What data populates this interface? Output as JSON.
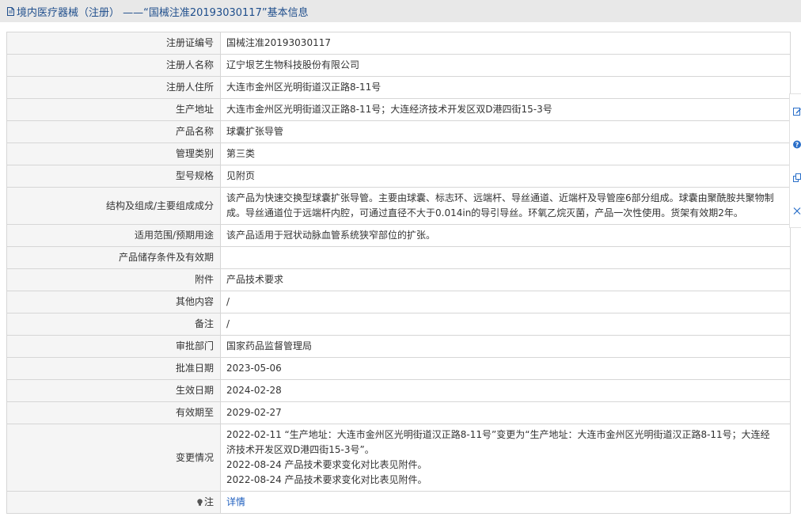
{
  "header": {
    "title": "境内医疗器械（注册） ——“国械注准20193030117”基本信息",
    "icon": "document-icon"
  },
  "rows": [
    {
      "label": "注册证编号",
      "lines": [
        "国械注准20193030117"
      ]
    },
    {
      "label": "注册人名称",
      "lines": [
        "辽宁垠艺生物科技股份有限公司"
      ]
    },
    {
      "label": "注册人住所",
      "lines": [
        "大连市金州区光明街道汉正路8-11号"
      ]
    },
    {
      "label": "生产地址",
      "lines": [
        "大连市金州区光明街道汉正路8-11号；大连经济技术开发区双D港四街15-3号"
      ]
    },
    {
      "label": "产品名称",
      "lines": [
        "球囊扩张导管"
      ]
    },
    {
      "label": "管理类别",
      "lines": [
        "第三类"
      ]
    },
    {
      "label": "型号规格",
      "lines": [
        "见附页"
      ]
    },
    {
      "label": "结构及组成/主要组成成分",
      "lines": [
        "该产品为快速交换型球囊扩张导管。主要由球囊、标志环、远端杆、导丝通道、近端杆及导管座6部分组成。球囊由聚酰胺共聚物制",
        "成。导丝通道位于远端杆内腔，可通过直径不大于0.014in的导引导丝。环氧乙烷灭菌，产品一次性使用。货架有效期2年。"
      ]
    },
    {
      "label": "适用范围/预期用途",
      "lines": [
        "该产品适用于冠状动脉血管系统狭窄部位的扩张。"
      ]
    },
    {
      "label": "产品储存条件及有效期",
      "lines": [
        ""
      ]
    },
    {
      "label": "附件",
      "lines": [
        "产品技术要求"
      ]
    },
    {
      "label": "其他内容",
      "lines": [
        "/"
      ]
    },
    {
      "label": "备注",
      "lines": [
        "/"
      ]
    },
    {
      "label": "审批部门",
      "lines": [
        "国家药品监督管理局"
      ]
    },
    {
      "label": "批准日期",
      "lines": [
        "2023-05-06"
      ]
    },
    {
      "label": "生效日期",
      "lines": [
        "2024-02-28"
      ]
    },
    {
      "label": "有效期至",
      "lines": [
        "2029-02-27"
      ]
    },
    {
      "label": "变更情况",
      "lines": [
        "2022-02-11 “生产地址：大连市金州区光明街道汉正路8-11号”变更为“生产地址：大连市金州区光明街道汉正路8-11号；大连经",
        "济技术开发区双D港四街15-3号”。",
        "2022-08-24 产品技术要求变化对比表见附件。",
        "2022-08-24 产品技术要求变化对比表见附件。"
      ]
    }
  ],
  "note_row": {
    "label": "注",
    "link": "详情",
    "icon": "lightbulb-icon"
  },
  "side_tools": [
    "edit-icon",
    "help-icon",
    "copy-icon",
    "close-icon"
  ]
}
